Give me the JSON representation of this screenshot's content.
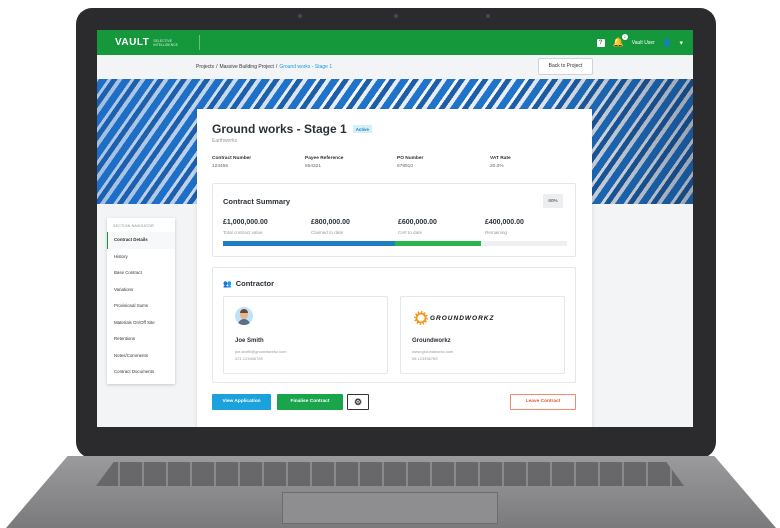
{
  "header": {
    "logo": "VAULT",
    "logo_sub": "SELECTIVE INTELLIGENCE",
    "help_icon": "question-icon",
    "notification_count": "2",
    "user_name": "Vault User"
  },
  "breadcrumb": {
    "items": [
      "Projects",
      "Massive Building Project"
    ],
    "current": "Ground works - Stage 1",
    "separator": "/",
    "back_button": "Back to Project"
  },
  "sidenav": {
    "title": "SECTION NAVIGATOR",
    "items": [
      "Contract Details",
      "History",
      "Base Contract",
      "Variations",
      "Provisional Sums",
      "Materials On/Off Site",
      "Retentions",
      "Notes/Comments",
      "Contract Documents"
    ],
    "active_index": 0
  },
  "contract": {
    "title": "Ground works - Stage 1",
    "status": "Active",
    "subtitle": "Earthworks",
    "meta": [
      {
        "label": "Contract Number",
        "value": "123456"
      },
      {
        "label": "Payee Reference",
        "value": "654321"
      },
      {
        "label": "PO Number",
        "value": "678910"
      },
      {
        "label": "VAT Rate",
        "value": "20.0%"
      }
    ]
  },
  "summary": {
    "title": "Contract Summary",
    "percent": "60%",
    "amounts": [
      {
        "value": "£1,000,000.00",
        "label": "Total contract value"
      },
      {
        "value": "£800,000.00",
        "label": "Claimed to date"
      },
      {
        "value": "£600,000.00",
        "label": "Cert to date"
      },
      {
        "value": "£400,000.00",
        "label": "Remaining"
      }
    ],
    "progress": {
      "certified_fraction": 0.5,
      "claimed_fraction": 0.75
    },
    "colors": {
      "certified": "#1d7fc0",
      "claimed": "#2bb34f"
    }
  },
  "contractor": {
    "title": "Contractor",
    "person": {
      "name": "Joe Smith",
      "email": "joe.smith@groundworkz.com",
      "phone": "021 123456789"
    },
    "company": {
      "logo_text": "GROUNDWORKZ",
      "name": "Groundworkz",
      "website": "www.groundworkz.com",
      "phone": "08 123456789"
    }
  },
  "actions": {
    "view_application": "View Application",
    "finalise_contract": "Finalise Contract",
    "settings_icon": "gear-icon",
    "leave_contract": "Leave Contract"
  },
  "colors": {
    "brand_green": "#15973c",
    "link_blue": "#1a9ad6",
    "danger": "#e2583a"
  }
}
